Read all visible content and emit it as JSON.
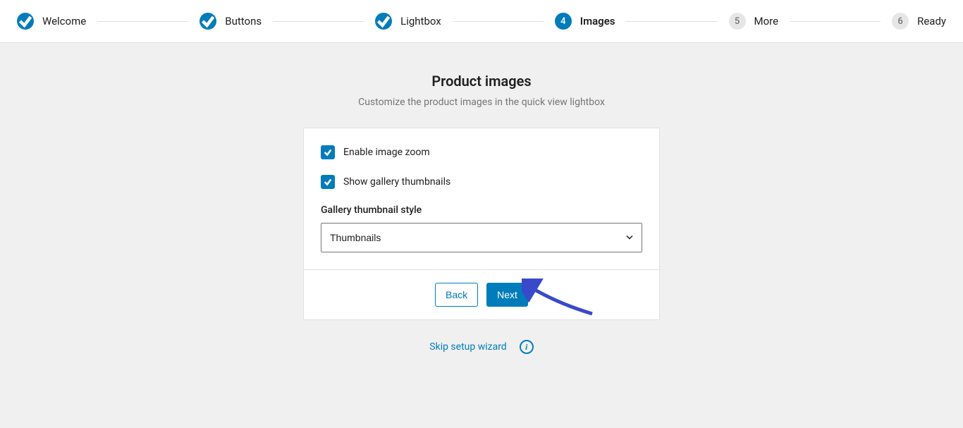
{
  "stepper": {
    "steps": [
      {
        "label": "Welcome",
        "state": "completed",
        "value": ""
      },
      {
        "label": "Buttons",
        "state": "completed",
        "value": ""
      },
      {
        "label": "Lightbox",
        "state": "completed",
        "value": ""
      },
      {
        "label": "Images",
        "state": "active",
        "value": "4"
      },
      {
        "label": "More",
        "state": "upcoming",
        "value": "5"
      },
      {
        "label": "Ready",
        "state": "upcoming",
        "value": "6"
      }
    ]
  },
  "page": {
    "title": "Product images",
    "subtitle": "Customize the product images in the quick view lightbox"
  },
  "form": {
    "enable_zoom_label": "Enable image zoom",
    "enable_zoom_checked": true,
    "show_thumbnails_label": "Show gallery thumbnails",
    "show_thumbnails_checked": true,
    "gallery_style_label": "Gallery thumbnail style",
    "gallery_style_value": "Thumbnails"
  },
  "footer": {
    "back_label": "Back",
    "next_label": "Next"
  },
  "skip": {
    "label": "Skip setup wizard"
  },
  "colors": {
    "primary": "#007cba"
  }
}
